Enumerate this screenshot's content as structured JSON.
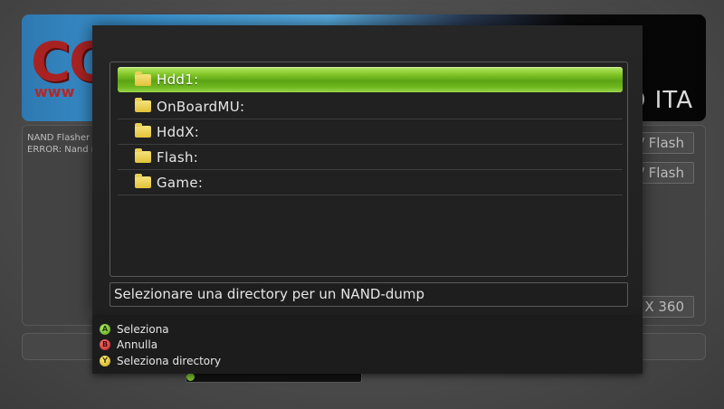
{
  "background": {
    "logo_text": "CO",
    "logo_sub": "www",
    "banner_title": "D ITA",
    "log_lines": [
      "NAND Flasher 3",
      "ERROR: Nand n"
    ],
    "buttons": [
      "/ Flash",
      "/ Flash",
      "X 360"
    ]
  },
  "dialog": {
    "items": [
      {
        "label": "Hdd1:",
        "icon": "folder-icon",
        "selected": true
      },
      {
        "label": "OnBoardMU:",
        "icon": "folder-icon",
        "selected": false
      },
      {
        "label": "HddX:",
        "icon": "folder-icon",
        "selected": false
      },
      {
        "label": "Flash:",
        "icon": "folder-icon",
        "selected": false
      },
      {
        "label": "Game:",
        "icon": "folder-icon",
        "selected": false
      }
    ],
    "description": "Selezionare una directory per un NAND-dump",
    "accent_color": "#6fb820"
  },
  "legend": {
    "items": [
      {
        "button": "A",
        "label": "Seleziona",
        "color": "#4f9a10"
      },
      {
        "button": "B",
        "label": "Annulla",
        "color": "#b81818"
      },
      {
        "button": "Y",
        "label": "Seleziona directory",
        "color": "#c8a410"
      }
    ]
  }
}
